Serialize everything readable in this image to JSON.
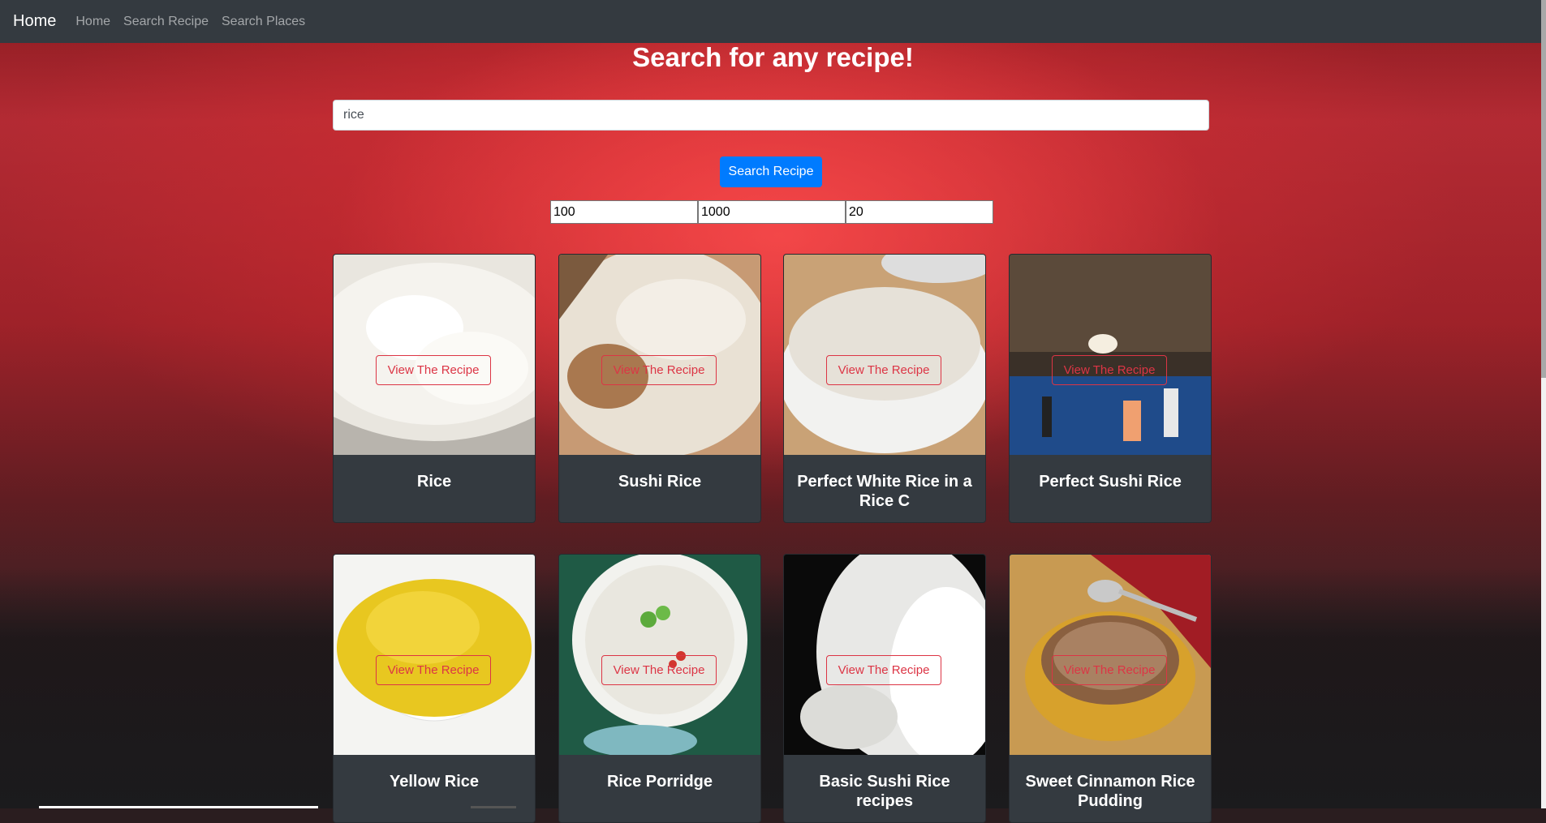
{
  "navbar": {
    "brand": "Home",
    "links": [
      "Home",
      "Search Recipe",
      "Search Places"
    ]
  },
  "page": {
    "title": "Search for any recipe!"
  },
  "search": {
    "value": "rice",
    "button_label": "Search Recipe"
  },
  "filters": [
    "100",
    "1000",
    "20"
  ],
  "cards": [
    {
      "title": "Rice",
      "button": "View The Recipe"
    },
    {
      "title": "Sushi Rice",
      "button": "View The Recipe"
    },
    {
      "title": "Perfect White Rice in a Rice C",
      "button": "View The Recipe"
    },
    {
      "title": "Perfect Sushi Rice",
      "button": "View The Recipe"
    },
    {
      "title": "Yellow Rice",
      "button": "View The Recipe"
    },
    {
      "title": "Rice Porridge",
      "button": "View The Recipe"
    },
    {
      "title": "Basic Sushi Rice recipes",
      "button": "View The Recipe"
    },
    {
      "title": "Sweet Cinnamon Rice Pudding",
      "button": "View The Recipe"
    }
  ],
  "colors": {
    "navbar": "#343a40",
    "primary": "#007bff",
    "danger": "#dc3545",
    "card": "#343a40"
  }
}
